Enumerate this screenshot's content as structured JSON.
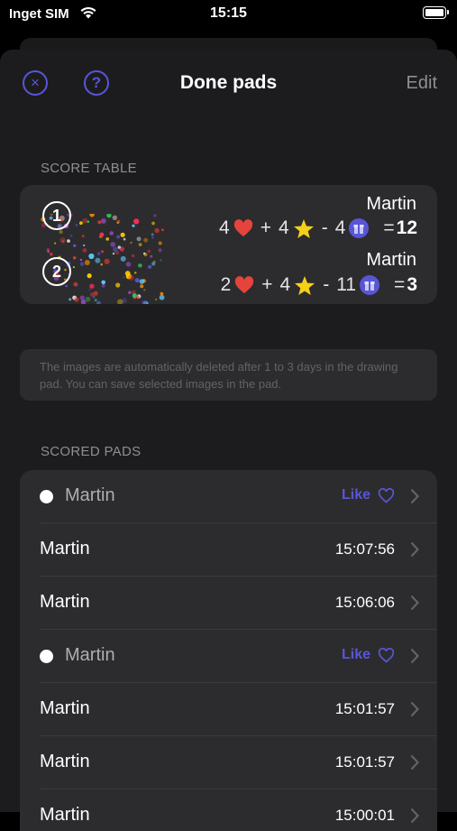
{
  "status_bar": {
    "carrier": "Inget SIM",
    "time": "15:15"
  },
  "header": {
    "title": "Done pads",
    "edit_label": "Edit",
    "close_icon": "close-icon",
    "help_icon": "help-icon",
    "help_glyph": "?",
    "close_glyph": "×"
  },
  "score_table": {
    "label": "SCORE TABLE",
    "entries": [
      {
        "rank": "1",
        "name": "Martin",
        "hearts": "4",
        "stars": "4",
        "gifts": "4",
        "plus": "+",
        "minus": "-",
        "equals": "=",
        "total": "12"
      },
      {
        "rank": "2",
        "name": "Martin",
        "hearts": "2",
        "stars": "4",
        "gifts": "11",
        "plus": "+",
        "minus": "-",
        "equals": "=",
        "total": "3"
      }
    ]
  },
  "info": {
    "text": "The images are automatically deleted after 1 to 3 days in the drawing pad. You can save selected images in the pad."
  },
  "scored_pads": {
    "label": "SCORED PADS",
    "rows": [
      {
        "name": "Martin",
        "right": "Like",
        "kind": "like"
      },
      {
        "name": "Martin",
        "right": "15:07:56",
        "kind": "time"
      },
      {
        "name": "Martin",
        "right": "15:06:06",
        "kind": "time"
      },
      {
        "name": "Martin",
        "right": "Like",
        "kind": "like"
      },
      {
        "name": "Martin",
        "right": "15:01:57",
        "kind": "time"
      },
      {
        "name": "Martin",
        "right": "15:01:57",
        "kind": "time"
      },
      {
        "name": "Martin",
        "right": "15:00:01",
        "kind": "time"
      }
    ]
  },
  "colors": {
    "accent": "#5856d6",
    "heart": "#e5443c",
    "star": "#f5d019",
    "background": "#1c1c1e",
    "card": "#2c2c2e"
  }
}
